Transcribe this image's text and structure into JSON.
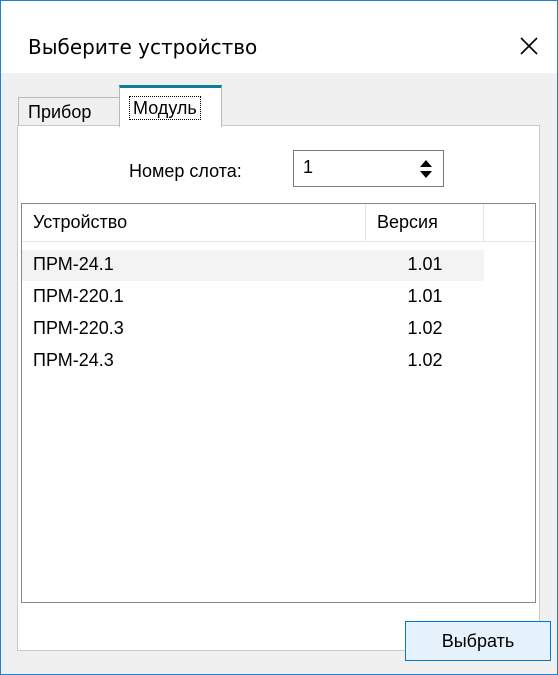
{
  "window": {
    "title": "Выберите устройство"
  },
  "tabs": [
    {
      "label": "Прибор",
      "selected": false
    },
    {
      "label": "Модуль",
      "selected": true
    }
  ],
  "slot": {
    "label": "Номер слота:",
    "value": "1"
  },
  "list": {
    "columns": [
      "Устройство",
      "Версия",
      ""
    ],
    "rows": [
      {
        "device": "ПРМ-24.1",
        "version": "1.01"
      },
      {
        "device": "ПРМ-220.1",
        "version": "1.01"
      },
      {
        "device": "ПРМ-220.3",
        "version": "1.02"
      },
      {
        "device": "ПРМ-24.3",
        "version": "1.02"
      }
    ]
  },
  "buttons": {
    "choose": "Выбрать"
  },
  "colors": {
    "accent": "#0078d7",
    "tab_accent": "#0c7e9a",
    "selected_row": "#f3f3f3"
  }
}
